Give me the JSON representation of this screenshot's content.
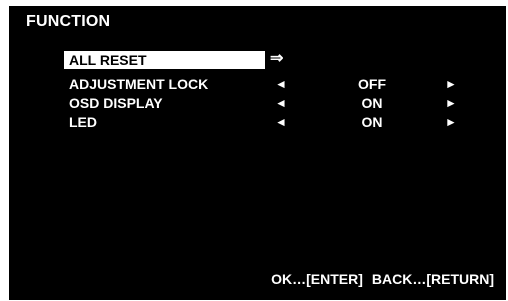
{
  "osd": {
    "title": "FUNCTION",
    "items": [
      {
        "label": "ALL RESET",
        "action_icon": "⇒"
      },
      {
        "label": "ADJUSTMENT LOCK",
        "left_icon": "◄",
        "value": "OFF",
        "right_icon": "►"
      },
      {
        "label": "OSD DISPLAY",
        "left_icon": "◄",
        "value": "ON",
        "right_icon": "►"
      },
      {
        "label": "LED",
        "left_icon": "◄",
        "value": "ON",
        "right_icon": "►"
      }
    ],
    "footer": {
      "ok_hint": "OK…[ENTER]",
      "back_hint": "BACK…[RETURN]"
    },
    "colors": {
      "background": "#000000",
      "text": "#ffffff",
      "highlight": "#ffffff"
    },
    "selected_item": "ALL RESET"
  }
}
